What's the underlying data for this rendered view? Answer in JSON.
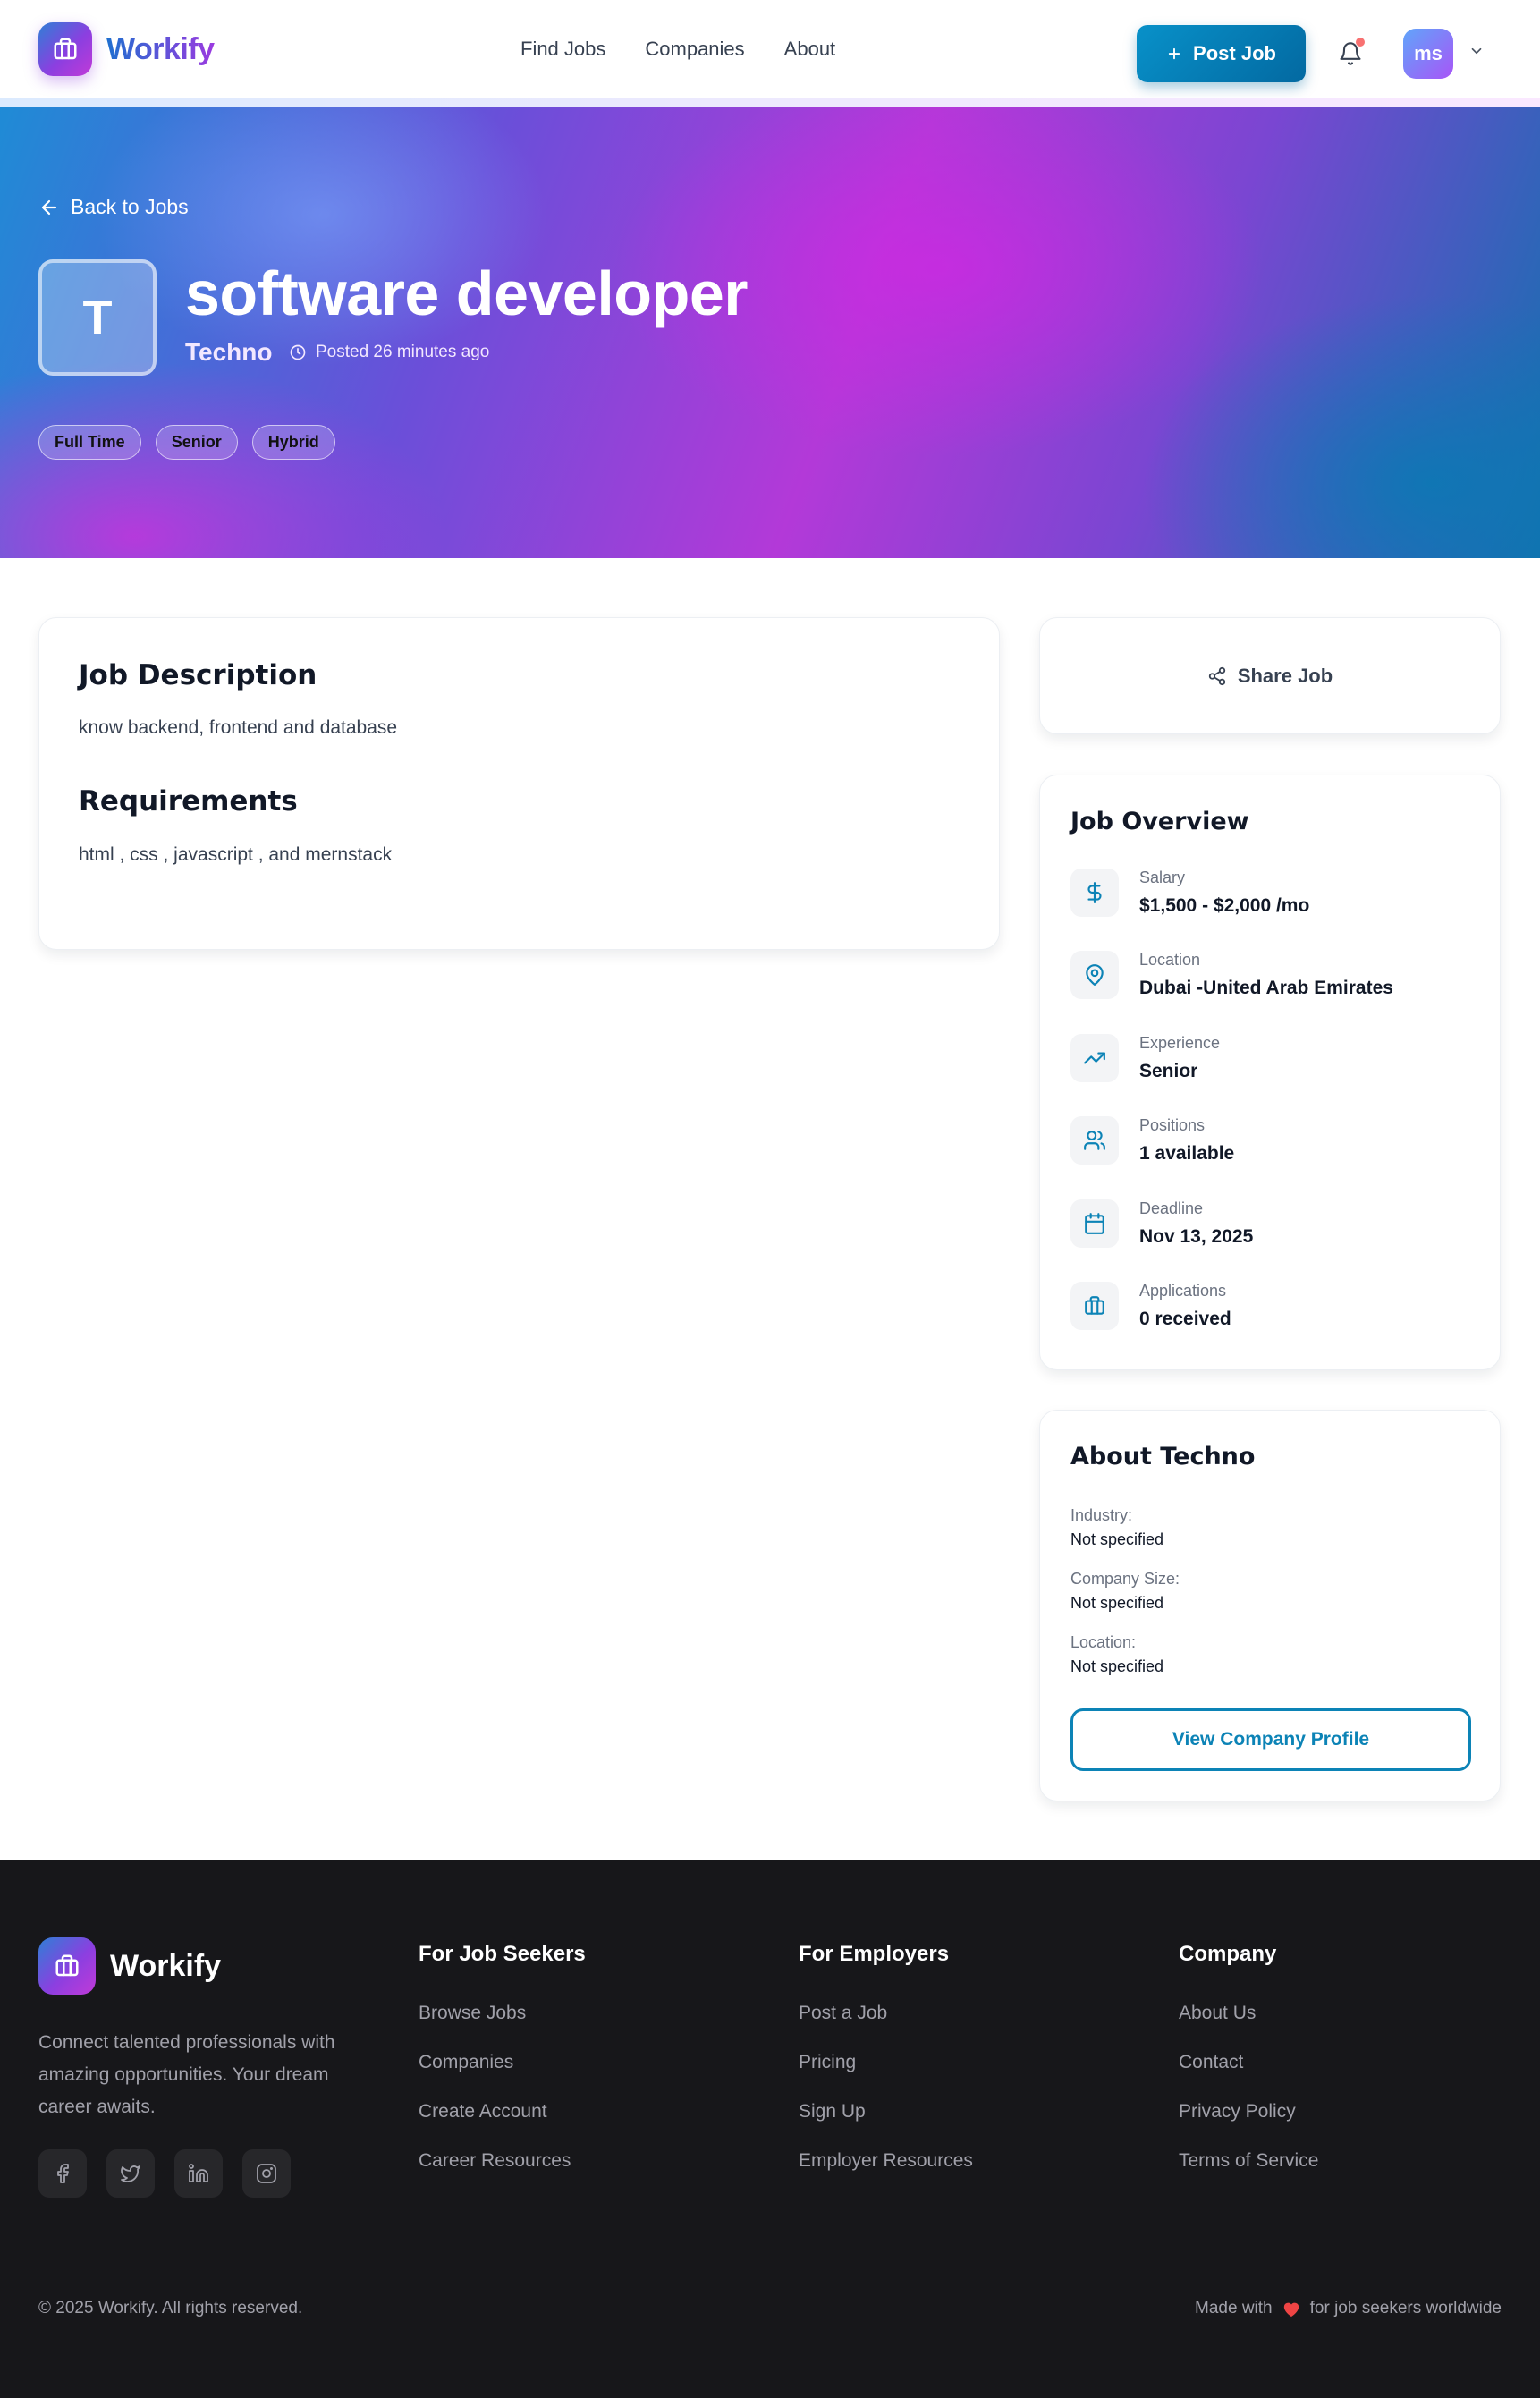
{
  "nav": {
    "brand": "Workify",
    "links": [
      "Find Jobs",
      "Companies",
      "About"
    ],
    "post_job_label": "Post Job",
    "avatar_initials": "ms"
  },
  "hero": {
    "back_label": "Back to Jobs",
    "company_initial": "T",
    "job_title": "software developer",
    "company": "Techno",
    "posted": "Posted 26 minutes ago",
    "tags": [
      "Full Time",
      "Senior",
      "Hybrid"
    ]
  },
  "description": {
    "title": "Job Description",
    "text": "know backend, frontend and database",
    "requirements_title": "Requirements",
    "requirements_text": "html , css , javascript , and mernstack"
  },
  "share": {
    "label": "Share Job"
  },
  "overview": {
    "title": "Job Overview",
    "items": [
      {
        "icon": "dollar-icon",
        "label": "Salary",
        "value": "$1,500 - $2,000 /mo"
      },
      {
        "icon": "map-pin-icon",
        "label": "Location",
        "value": "Dubai -United Arab Emirates"
      },
      {
        "icon": "trending-up-icon",
        "label": "Experience",
        "value": "Senior"
      },
      {
        "icon": "users-icon",
        "label": "Positions",
        "value": "1 available"
      },
      {
        "icon": "calendar-icon",
        "label": "Deadline",
        "value": "Nov 13, 2025"
      },
      {
        "icon": "briefcase-icon",
        "label": "Applications",
        "value": "0 received"
      }
    ]
  },
  "about": {
    "title": "About Techno",
    "fields": [
      {
        "label": "Industry:",
        "value": "Not specified"
      },
      {
        "label": "Company Size:",
        "value": "Not specified"
      },
      {
        "label": "Location:",
        "value": "Not specified"
      }
    ],
    "button_label": "View Company Profile"
  },
  "footer": {
    "brand": "Workify",
    "tagline": "Connect talented professionals with amazing opportunities. Your dream career awaits.",
    "columns": [
      {
        "title": "For Job Seekers",
        "links": [
          "Browse Jobs",
          "Companies",
          "Create Account",
          "Career Resources"
        ]
      },
      {
        "title": "For Employers",
        "links": [
          "Post a Job",
          "Pricing",
          "Sign Up",
          "Employer Resources"
        ]
      },
      {
        "title": "Company",
        "links": [
          "About Us",
          "Contact",
          "Privacy Policy",
          "Terms of Service"
        ]
      }
    ],
    "copyright": "© 2025 Workify. All rights reserved.",
    "made_with_prefix": "Made with",
    "made_with_suffix": "for job seekers worldwide"
  },
  "colors": {
    "accent": "#0c83b6",
    "brand_gradient_start": "#2f7fd6",
    "brand_gradient_end": "#c13ad8",
    "footer_bg": "#17171a",
    "heart": "#ef4444"
  }
}
